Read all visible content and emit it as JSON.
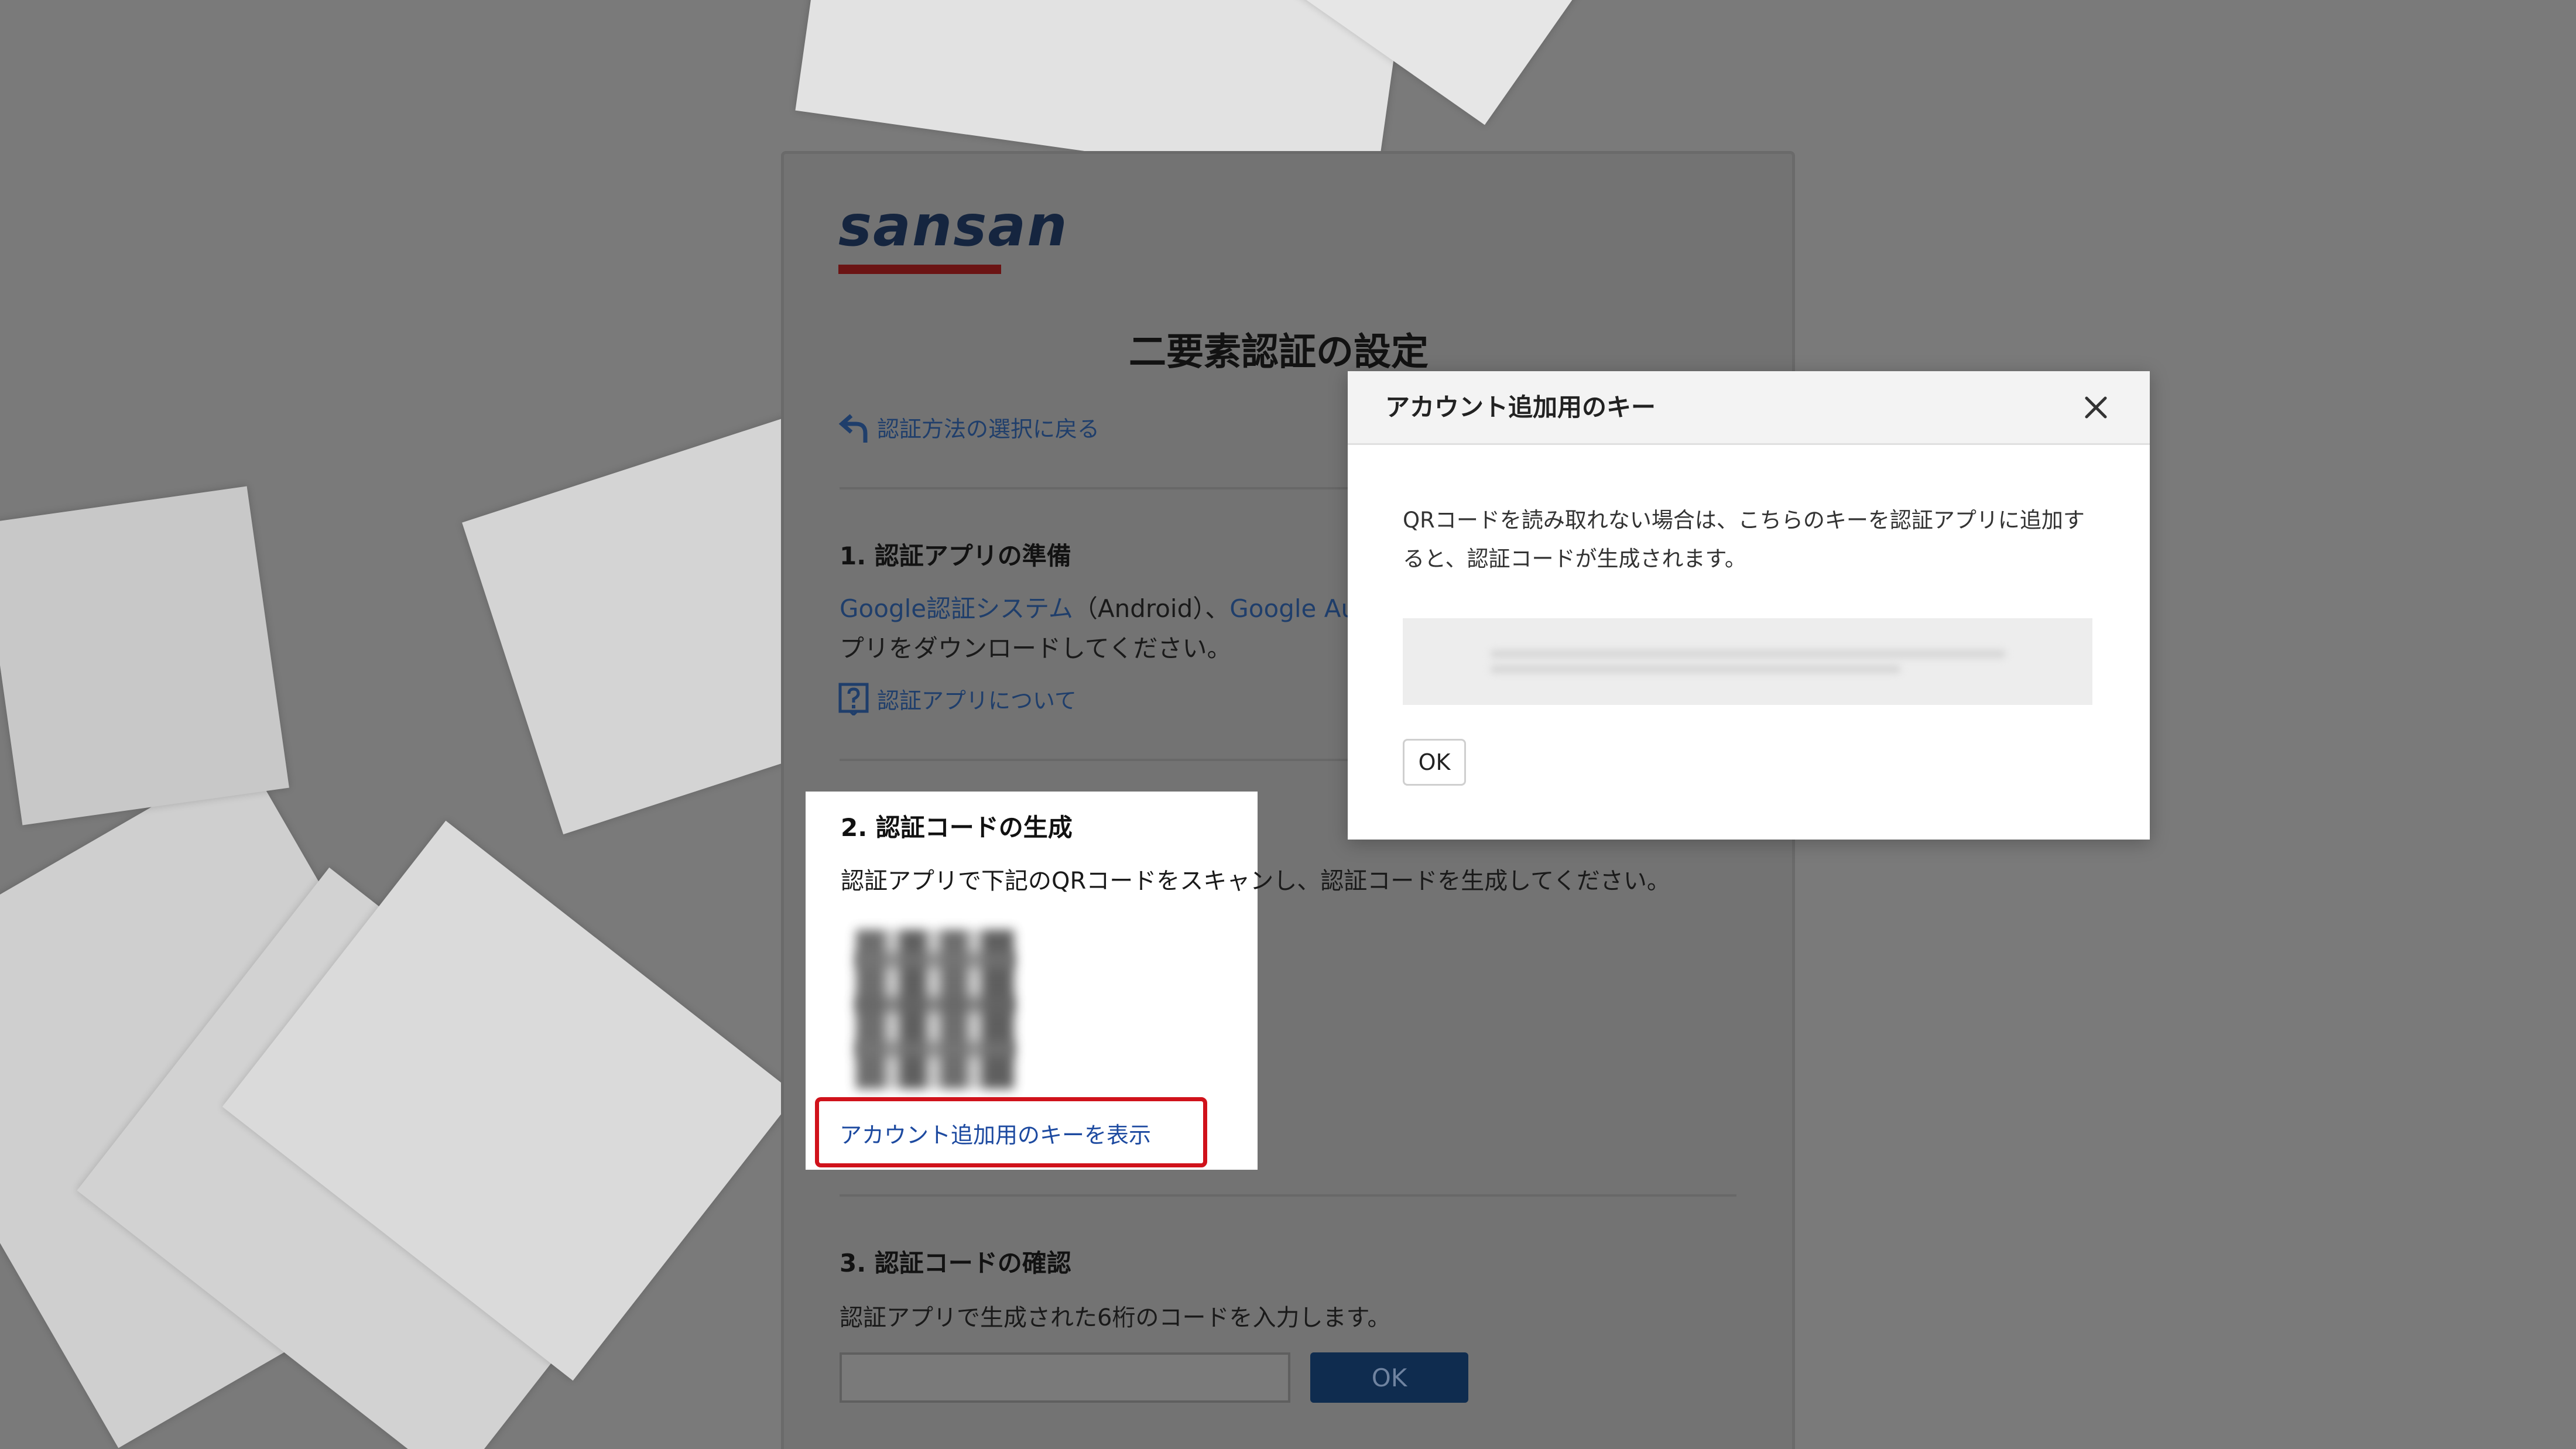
{
  "brand": {
    "logo_text": "sansan",
    "accent_color": "#d0121b",
    "link_color": "#1d4aa0"
  },
  "page": {
    "title": "二要素認証の設定",
    "back_link": "認証方法の選択に戻る",
    "back_icon": "back-arrow-icon"
  },
  "step1": {
    "heading": "1. 認証アプリの準備",
    "link_google_android": "Google認証システム",
    "text_android": "（Android）、",
    "link_google_ios": "Google Au",
    "text_line2": "プリをダウンロードしてください。",
    "help_icon": "question-icon",
    "help_link": "認証アプリについて"
  },
  "step2": {
    "heading": "2. 認証コードの生成",
    "instruction": "認証アプリで下記のQRコードをスキャンし、認証コードを生成してください。",
    "show_key_link": "アカウント追加用のキーを表示"
  },
  "step3": {
    "heading": "3. 認証コードの確認",
    "instruction": "認証アプリで生成された6桁のコードを入力します。",
    "input_value": "",
    "ok_label": "OK"
  },
  "modal": {
    "title": "アカウント追加用のキー",
    "close_icon": "close-icon",
    "description": "QRコードを読み取れない場合は、こちらのキーを認証アプリに追加すると、認証コードが生成されます。",
    "ok_label": "OK"
  }
}
